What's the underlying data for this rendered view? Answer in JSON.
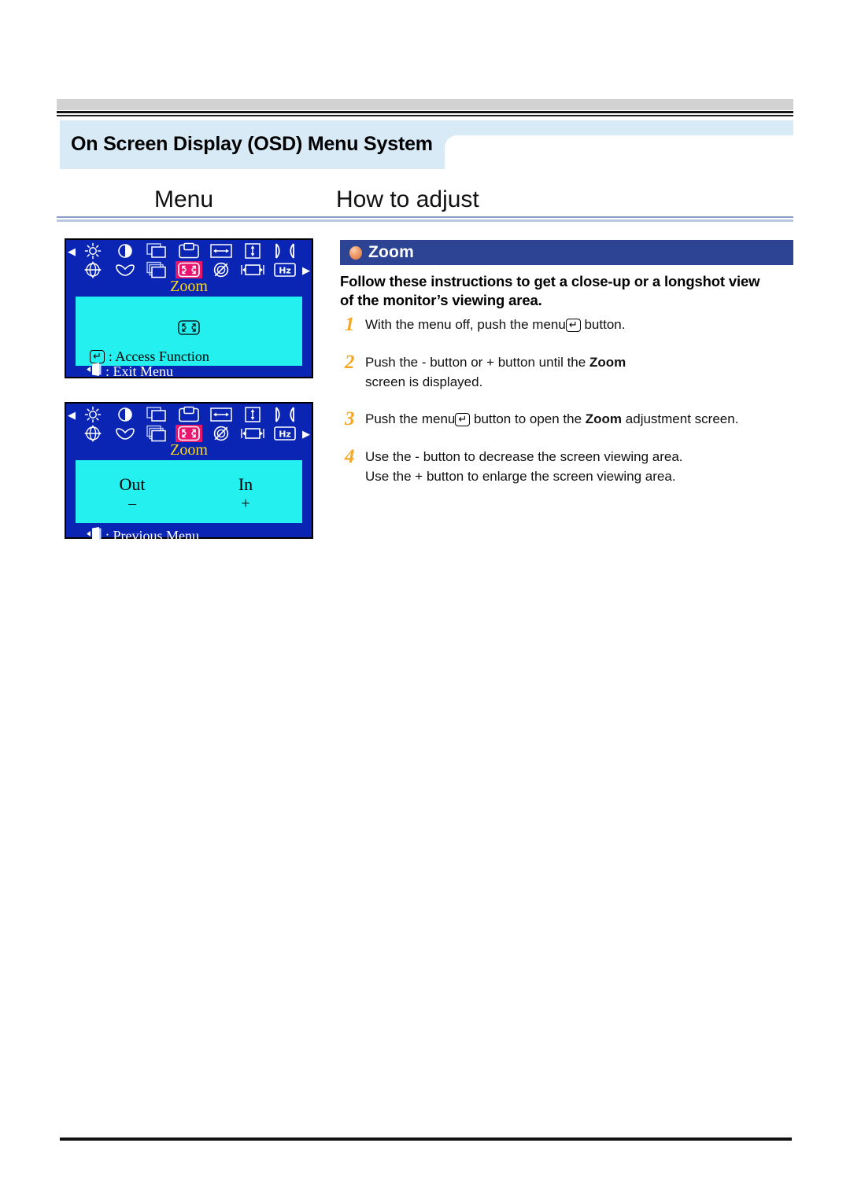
{
  "page": {
    "section_title": "On Screen Display (OSD) Menu System",
    "column_headings": {
      "left": "Menu",
      "right": "How to adjust"
    }
  },
  "osd_panels": [
    {
      "name": "zoom-menu-selected",
      "menu_label": "Zoom",
      "icons_row1": [
        "brightness-icon",
        "contrast-icon",
        "image-position-icon",
        "image-size-icon",
        "h-position-icon",
        "v-position-icon",
        "pincushion-icon"
      ],
      "icons_row2": [
        "rotation-icon",
        "trapezoid-icon",
        "parallelogram-icon",
        "zoom-icon",
        "degauss-icon",
        "h-size-icon",
        "frequency-hz-icon"
      ],
      "highlighted_icon": "zoom-icon",
      "screen_icon": "zoom-icon",
      "access_key": "enter-key",
      "access_text": ": Access Function",
      "exit_key": "exit-door-icon",
      "exit_text": ": Exit Menu"
    },
    {
      "name": "zoom-adjust-screen",
      "menu_label": "Zoom",
      "icons_row1": [
        "brightness-icon",
        "contrast-icon",
        "image-position-icon",
        "image-size-icon",
        "h-position-icon",
        "v-position-icon",
        "pincushion-icon"
      ],
      "icons_row2": [
        "rotation-icon",
        "trapezoid-icon",
        "parallelogram-icon",
        "zoom-icon",
        "degauss-icon",
        "h-size-icon",
        "frequency-hz-icon"
      ],
      "highlighted_icon": "zoom-icon",
      "out_label": "Out",
      "out_sign": "–",
      "in_label": "In",
      "in_sign": "+",
      "exit_key": "exit-door-icon",
      "exit_text": ": Previous Menu"
    }
  ],
  "zoom_section": {
    "banner_title": "Zoom",
    "bullet": "orange-sphere-bullet",
    "intro_line1": "Follow these instructions to get a close-up or a longshot view",
    "intro_line2": "of the monitor’s viewing area.",
    "steps": [
      {
        "number": "1",
        "parts": [
          {
            "text": "With the menu off, push the menu",
            "bold": false
          },
          {
            "key": "enter-key"
          },
          {
            "text": " button.",
            "bold": false
          }
        ]
      },
      {
        "number": "2",
        "parts": [
          {
            "text": "Push the  - button or  + button until the ",
            "bold": false
          },
          {
            "text": "Zoom",
            "bold": true
          },
          {
            "text": "\nscreen is displayed.",
            "bold": false
          }
        ]
      },
      {
        "number": "3",
        "parts": [
          {
            "text": "Push the menu",
            "bold": false
          },
          {
            "key": "enter-key"
          },
          {
            "text": " button to open the ",
            "bold": false
          },
          {
            "text": "Zoom",
            "bold": true
          },
          {
            "text": " adjustment screen.",
            "bold": false
          }
        ]
      },
      {
        "number": "4",
        "parts": [
          {
            "text": "Use the  - button to decrease the screen viewing area.\nUse the  + button to enlarge the screen viewing area.",
            "bold": false
          }
        ]
      }
    ]
  },
  "colors": {
    "band_light_blue": "#d9eaf7",
    "banner_blue": "#2d4494",
    "osd_blue": "#0a24b4",
    "osd_cyan": "#25f0f0",
    "osd_yellow": "#ffd91b",
    "highlight_pink": "#e8166e",
    "step_number_orange": "#f5a623",
    "rule_blue": "#8a9bc4"
  }
}
